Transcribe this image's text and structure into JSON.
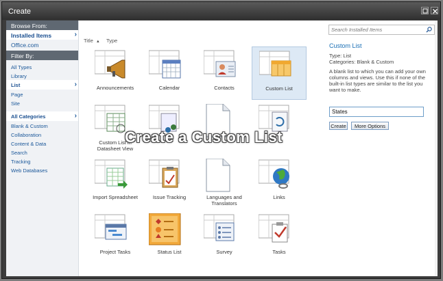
{
  "window": {
    "title": "Create"
  },
  "browse_from": {
    "header": "Browse From:",
    "items": [
      {
        "label": "Installed Items",
        "selected": true
      },
      {
        "label": "Office.com",
        "selected": false
      }
    ]
  },
  "filter_by": {
    "header": "Filter By:",
    "types": [
      "All Types",
      "Library",
      "List",
      "Page",
      "Site"
    ],
    "selected_type": "List",
    "categories_header": "All Categories",
    "categories": [
      "Blank & Custom",
      "Collaboration",
      "Content & Data",
      "Search",
      "Tracking",
      "Web Databases"
    ]
  },
  "sort": {
    "title": "Title",
    "type": "Type"
  },
  "templates": [
    {
      "label": "Announcements",
      "icon": "megaphone-icon"
    },
    {
      "label": "Calendar",
      "icon": "calendar-icon"
    },
    {
      "label": "Contacts",
      "icon": "contact-card-icon"
    },
    {
      "label": "Custom List",
      "icon": "custom-list-icon",
      "selected": true
    },
    {
      "label": "Custom List in Datasheet View",
      "icon": "datasheet-icon"
    },
    {
      "label": "Discussion Board",
      "icon": "discussion-icon"
    },
    {
      "label": "External List",
      "icon": "document-icon"
    },
    {
      "label": "Import Spreadsheet",
      "icon": "sync-list-icon"
    },
    {
      "label": "Import Spreadsheet",
      "icon": "spreadsheet-import-icon"
    },
    {
      "label": "Issue Tracking",
      "icon": "clipboard-icon"
    },
    {
      "label": "Languages and Translators",
      "icon": "document-icon"
    },
    {
      "label": "Links",
      "icon": "globe-link-icon"
    },
    {
      "label": "Project Tasks",
      "icon": "project-tasks-icon"
    },
    {
      "label": "Status List",
      "icon": "status-list-icon"
    },
    {
      "label": "Survey",
      "icon": "survey-icon"
    },
    {
      "label": "Tasks",
      "icon": "tasks-icon"
    }
  ],
  "visible_labels": {
    "r0c0": "Announcements",
    "r0c1": "Calendar",
    "r0c2": "Contacts",
    "r0c3": "Custom List",
    "r1c0": "Custom List in Datasheet View",
    "r2c0": "Import Spreadsheet",
    "r2c1": "Issue Tracking",
    "r2c2": "Languages and Translators",
    "r2c3": "Links",
    "r3c0": "Project Tasks",
    "r3c1": "Status List",
    "r3c2": "Survey",
    "r3c3": "Tasks"
  },
  "details": {
    "search_placeholder": "Search Installed Items",
    "title": "Custom List",
    "type_line": "Type: List",
    "categories_line": "Categories: Blank & Custom",
    "description": "A blank list to which you can add your own columns and views. Use this if none of the built-in list types are similar to the list you want to make.",
    "name_value": "States",
    "create_label": "Create",
    "more_options_label": "More Options"
  },
  "overlay_caption": "Create a Custom List",
  "colors": {
    "accent": "#1a6fb5",
    "selected_tile": "#dde9f5",
    "nav_header": "#5f6872"
  }
}
